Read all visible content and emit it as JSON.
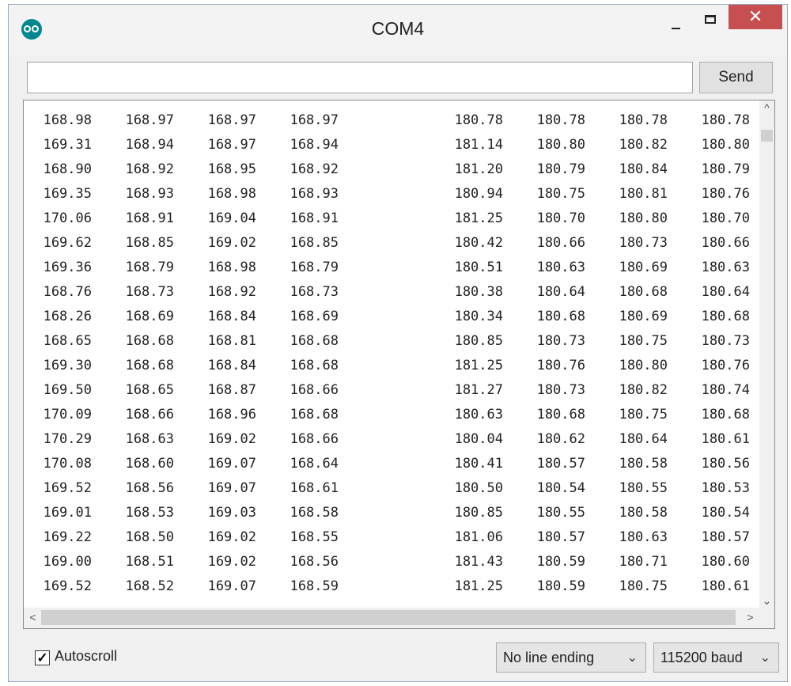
{
  "window": {
    "title": "COM4",
    "close_symbol": "✕"
  },
  "input": {
    "value": "",
    "send_label": "Send"
  },
  "output": {
    "rows": [
      [
        "168.98",
        "168.97",
        "168.97",
        "168.97",
        "180.78",
        "180.78",
        "180.78",
        "180.78"
      ],
      [
        "169.31",
        "168.94",
        "168.97",
        "168.94",
        "181.14",
        "180.80",
        "180.82",
        "180.80"
      ],
      [
        "168.90",
        "168.92",
        "168.95",
        "168.92",
        "181.20",
        "180.79",
        "180.84",
        "180.79"
      ],
      [
        "169.35",
        "168.93",
        "168.98",
        "168.93",
        "180.94",
        "180.75",
        "180.81",
        "180.76"
      ],
      [
        "170.06",
        "168.91",
        "169.04",
        "168.91",
        "181.25",
        "180.70",
        "180.80",
        "180.70"
      ],
      [
        "169.62",
        "168.85",
        "169.02",
        "168.85",
        "180.42",
        "180.66",
        "180.73",
        "180.66"
      ],
      [
        "169.36",
        "168.79",
        "168.98",
        "168.79",
        "180.51",
        "180.63",
        "180.69",
        "180.63"
      ],
      [
        "168.76",
        "168.73",
        "168.92",
        "168.73",
        "180.38",
        "180.64",
        "180.68",
        "180.64"
      ],
      [
        "168.26",
        "168.69",
        "168.84",
        "168.69",
        "180.34",
        "180.68",
        "180.69",
        "180.68"
      ],
      [
        "168.65",
        "168.68",
        "168.81",
        "168.68",
        "180.85",
        "180.73",
        "180.75",
        "180.73"
      ],
      [
        "169.30",
        "168.68",
        "168.84",
        "168.68",
        "181.25",
        "180.76",
        "180.80",
        "180.76"
      ],
      [
        "169.50",
        "168.65",
        "168.87",
        "168.66",
        "181.27",
        "180.73",
        "180.82",
        "180.74"
      ],
      [
        "170.09",
        "168.66",
        "168.96",
        "168.68",
        "180.63",
        "180.68",
        "180.75",
        "180.68"
      ],
      [
        "170.29",
        "168.63",
        "169.02",
        "168.66",
        "180.04",
        "180.62",
        "180.64",
        "180.61"
      ],
      [
        "170.08",
        "168.60",
        "169.07",
        "168.64",
        "180.41",
        "180.57",
        "180.58",
        "180.56"
      ],
      [
        "169.52",
        "168.56",
        "169.07",
        "168.61",
        "180.50",
        "180.54",
        "180.55",
        "180.53"
      ],
      [
        "169.01",
        "168.53",
        "169.03",
        "168.58",
        "180.85",
        "180.55",
        "180.58",
        "180.54"
      ],
      [
        "169.22",
        "168.50",
        "169.02",
        "168.55",
        "181.06",
        "180.57",
        "180.63",
        "180.57"
      ],
      [
        "169.00",
        "168.51",
        "169.02",
        "168.56",
        "181.43",
        "180.59",
        "180.71",
        "180.60"
      ],
      [
        "169.52",
        "168.52",
        "169.07",
        "168.59",
        "181.25",
        "180.59",
        "180.75",
        "180.61"
      ]
    ]
  },
  "footer": {
    "autoscroll_label": "Autoscroll",
    "autoscroll_checked": true,
    "line_ending": "No line ending",
    "baud": "115200 baud"
  },
  "icons": {
    "up": "^",
    "down": "⌄",
    "left": "<",
    "right": ">",
    "dropdown": "⌄",
    "check": "✓"
  },
  "colors": {
    "app_icon": "#00878f",
    "close_button": "#c74f4f"
  }
}
